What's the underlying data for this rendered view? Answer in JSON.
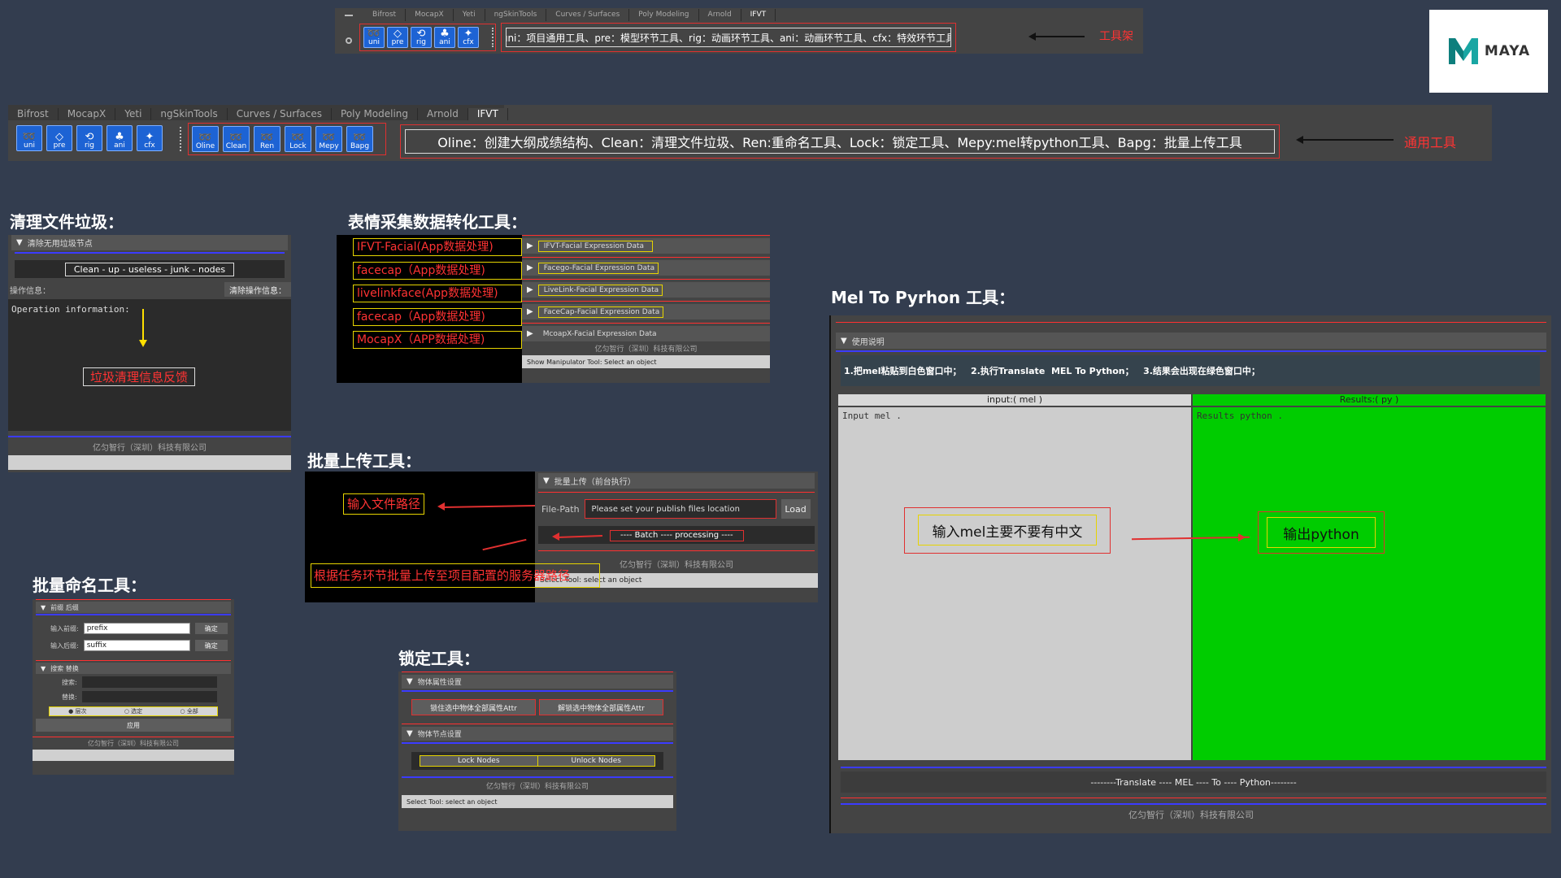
{
  "tab_names": [
    "Bifrost",
    "MocapX",
    "Yeti",
    "ngSkinTools",
    "Curves / Surfaces",
    "Poly Modeling",
    "Arnold",
    "IFVT"
  ],
  "top_shelf": {
    "tabs": [
      "Bifrost",
      "MocapX",
      "Yeti",
      "ngSkinTools",
      "Curves / Surfaces",
      "Poly Modeling",
      "Arnold",
      "IFVT"
    ],
    "icons": [
      "uni",
      "pre",
      "rig",
      "ani",
      "cfx"
    ],
    "description": "uni：项目通用工具、pre：模型环节工具、rig：动画环节工具、ani：动画环节工具、cfx：特效环节工具",
    "callout": "工具架"
  },
  "logo": {
    "text": "MAYA"
  },
  "main_shelf": {
    "left_icons": [
      "uni",
      "pre",
      "rig",
      "ani",
      "cfx"
    ],
    "right_icons": [
      "Oline",
      "Clean",
      "Ren",
      "Lock",
      "Mepy",
      "Bapg"
    ],
    "description": "Oline：创建大纲成绩结构、Clean：清理文件垃圾、Ren:重命名工具、Lock：锁定工具、Mepy:mel转python工具、Bapg：批量上传工具",
    "callout": "通用工具"
  },
  "clean": {
    "title": "清理文件垃圾：",
    "frame": "清除无用垃圾节点",
    "button": "Clean - up - useless - junk - nodes",
    "info_label": "操作信息：",
    "clear_button": "清除操作信息：",
    "log_text": "Operation information:",
    "callout": "垃圾清理信息反馈",
    "copyright": "亿匀智行（深圳）科技有限公司"
  },
  "facial": {
    "title": "表情采集数据转化工具：",
    "labels": [
      "IFVT-Facial(App数据处理)",
      "facecap（App数据处理)",
      "livelinkface(App数据处理)",
      "facecap（App数据处理)",
      "MocapX（APP数据处理)"
    ],
    "frames": [
      "IFVT-Facial Expression Data",
      "Facego-Facial Expression Data",
      "LiveLink-Facial Expression Data",
      "FaceCap-Facial Expression Data",
      "McoapX-Facial Expression Data"
    ],
    "copyright": "亿匀智行（深圳）科技有限公司",
    "status": "Show Manipulator Tool: Select an object"
  },
  "upload": {
    "title": "批量上传工具：",
    "frame": "批量上传（前台执行）",
    "path_label": "File-Path",
    "path_placeholder": "Please set your publish files location",
    "load": "Load",
    "batch": "---- Batch ---- processing ----",
    "callout1": "输入文件路径",
    "callout2": "根据任务环节批量上传至项目配置的服务器路径",
    "copyright": "亿匀智行（深圳）科技有限公司",
    "status": "Select Tool: select an object"
  },
  "rename": {
    "title": "批量命名工具：",
    "frame1": "前缀 后缀",
    "prefix_label": "输入前缀:",
    "prefix_value": "prefix",
    "suffix_label": "输入后缀:",
    "suffix_value": "suffix",
    "confirm": "确定",
    "frame2": "搜索 替换",
    "search_label": "搜索:",
    "replace_label": "替换:",
    "radios": [
      "层次",
      "选定",
      "全部"
    ],
    "apply": "应用",
    "copyright": "亿匀智行（深圳）科技有限公司"
  },
  "lock": {
    "title": "锁定工具：",
    "frame1": "物体属性设置",
    "lock_attr": "锁住选中物体全部属性Attr",
    "unlock_attr": "解锁选中物体全部属性Attr",
    "frame2": "物体节点设置",
    "lock_nodes": "Lock Nodes",
    "unlock_nodes": "Unlock Nodes",
    "copyright": "亿匀智行（深圳）科技有限公司",
    "status": "Select Tool: select an object"
  },
  "mel": {
    "title": "Mel To Pyrhon 工具：",
    "frame": "使用说明",
    "instructions": "1.把mel粘贴到白色窗口中；   2.执行Translate  MEL To Python；   3.结果会出现在绿色窗口中；",
    "input_header": "input:( mel )",
    "result_header": "Results:( py )",
    "input_placeholder": "Input mel .",
    "result_placeholder": "Results python .",
    "callout_in": "输入mel主要不要有中文",
    "callout_out": "输出python",
    "translate": "--------Translate ---- MEL ---- To ---- Python--------",
    "copyright": "亿匀智行（深圳）科技有限公司"
  }
}
